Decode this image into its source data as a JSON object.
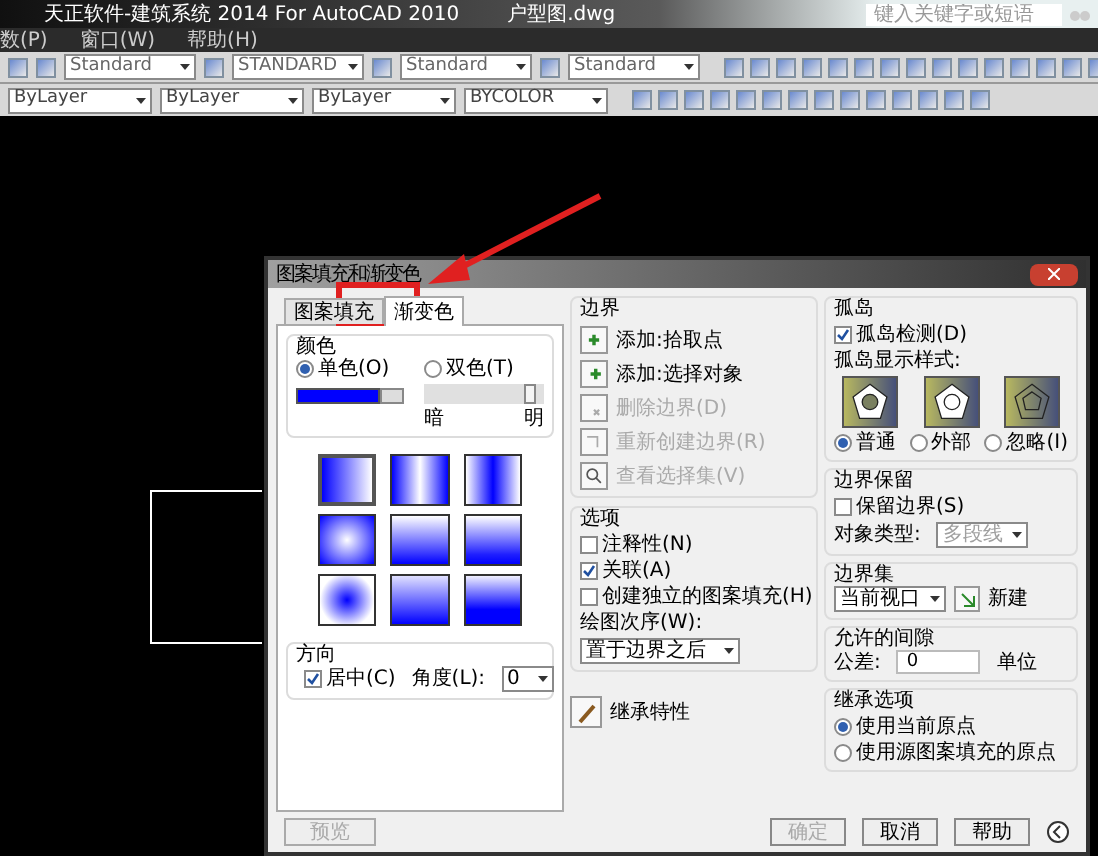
{
  "app": {
    "title": "天正软件-建筑系统 2014  For AutoCAD 2010",
    "file": "户型图.dwg",
    "search": {
      "placeholder": "键入关键字或短语"
    }
  },
  "menu": [
    "数(P)",
    "窗口(W)",
    "帮助(H)"
  ],
  "toolbar_styles": [
    "Standard",
    "STANDARD",
    "Standard",
    "Standard"
  ],
  "toolbar_properties": [
    "ByLayer",
    "ByLayer",
    "ByLayer",
    "BYCOLOR"
  ],
  "dialog": {
    "title": "图案填充和渐变色",
    "tabs": [
      {
        "label": "图案填充",
        "selected": false
      },
      {
        "label": "渐变色",
        "selected": true
      }
    ],
    "color": {
      "title": "颜色",
      "modes": [
        {
          "label": "单色(O)",
          "selected": true
        },
        {
          "label": "双色(T)",
          "selected": false
        }
      ],
      "shade": {
        "level": 0.93,
        "dark": "暗",
        "light": "明"
      }
    },
    "gradients": [
      {
        "kind": "linear",
        "selected": true
      },
      {
        "kind": "cylinder",
        "selected": false
      },
      {
        "kind": "inv-cylinder",
        "selected": false
      },
      {
        "kind": "spherical",
        "selected": false
      },
      {
        "kind": "hemispherical",
        "selected": false
      },
      {
        "kind": "curved",
        "selected": false
      },
      {
        "kind": "inv-spherical",
        "selected": false
      },
      {
        "kind": "inv-hemispherical",
        "selected": false
      },
      {
        "kind": "inv-curved",
        "selected": false
      }
    ],
    "direction": {
      "title": "方向",
      "centered": {
        "label": "居中(C)",
        "checked": true
      },
      "angle_label": "角度(L):",
      "angle": "0"
    },
    "preview": {
      "label": "预览",
      "disabled": true
    },
    "boundaries": {
      "title": "边界",
      "buttons": [
        {
          "label": "添加:拾取点",
          "disabled": false,
          "kind": "pick"
        },
        {
          "label": "添加:选择对象",
          "disabled": false,
          "kind": "select"
        },
        {
          "label": "删除边界(D)",
          "disabled": true,
          "kind": "remove"
        },
        {
          "label": "重新创建边界(R)",
          "disabled": true,
          "kind": "recreate"
        },
        {
          "label": "查看选择集(V)",
          "disabled": true,
          "kind": "view"
        }
      ]
    },
    "options": {
      "title": "选项",
      "checkboxes": [
        {
          "label": "注释性(N)",
          "checked": false
        },
        {
          "label": "关联(A)",
          "checked": true
        },
        {
          "label": "创建独立的图案填充(H)",
          "checked": false
        }
      ],
      "draw_order_label": "绘图次序(W):",
      "draw_order": "置于边界之后"
    },
    "inherit": "继承特性",
    "islands": {
      "title": "孤岛",
      "detect": {
        "label": "孤岛检测(D)",
        "checked": true
      },
      "style_label": "孤岛显示样式:",
      "styles": [
        {
          "label": "普通",
          "selected": true,
          "kind": "normal"
        },
        {
          "label": "外部",
          "selected": false,
          "kind": "outer"
        },
        {
          "label": "忽略(I)",
          "selected": false,
          "kind": "ignore"
        }
      ]
    },
    "retention": {
      "title": "边界保留",
      "retain": {
        "label": "保留边界(S)",
        "checked": false
      },
      "type_label": "对象类型:",
      "type": "多段线"
    },
    "boundary_set": {
      "title": "边界集",
      "value": "当前视口",
      "new": "新建"
    },
    "gap": {
      "title": "允许的间隙",
      "label": "公差:",
      "value": "0",
      "unit": "单位"
    },
    "inherit_options": {
      "title": "继承选项",
      "radios": [
        {
          "label": "使用当前原点",
          "selected": true
        },
        {
          "label": "使用源图案填充的原点",
          "selected": false
        }
      ]
    },
    "footer": [
      {
        "label": "确定",
        "disabled": true
      },
      {
        "label": "取消",
        "disabled": false
      },
      {
        "label": "帮助",
        "disabled": false
      }
    ]
  }
}
